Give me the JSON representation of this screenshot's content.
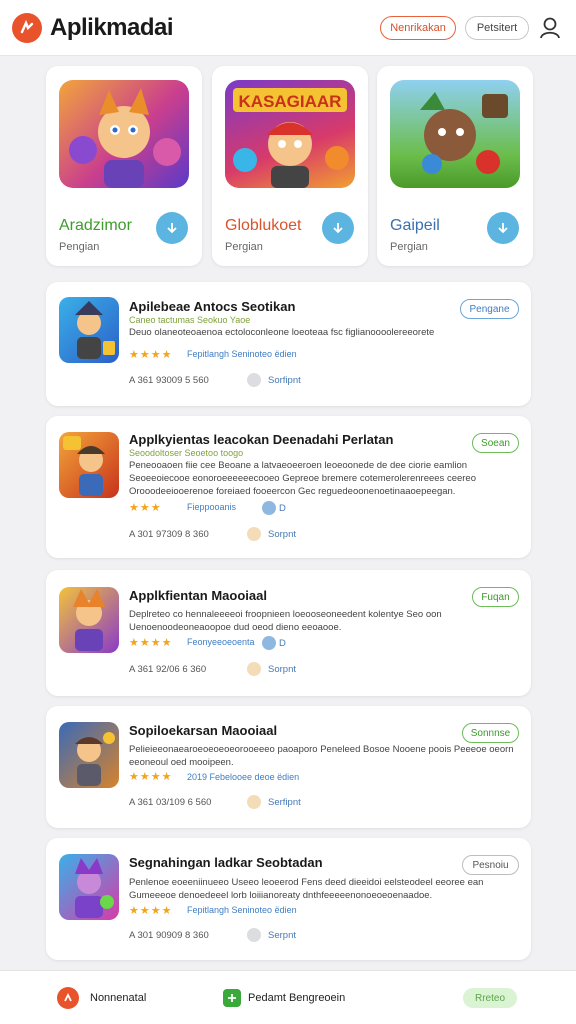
{
  "header": {
    "app_title": "Aplikmadai",
    "btn_primary": "Nenrikakan",
    "btn_secondary": "Petsitert"
  },
  "featured": [
    {
      "art_title": "KASAGIAAR",
      "name": "Aradzimor",
      "name_color": "#3e9c2c",
      "sub": "Pengian"
    },
    {
      "art_title": "",
      "name": "Globlukoet",
      "name_color": "#d9532b",
      "sub": "Pergian"
    },
    {
      "art_title": "",
      "name": "Gaipeil",
      "name_color": "#3a6fb0",
      "sub": "Pergian"
    }
  ],
  "items": [
    {
      "title": "Apilebeae Antocs Seotikan",
      "tag": "Caneo tactumas Seokuo Yaoe",
      "desc": "Deuo olaneoteoaenoa ectoloconleone loeoteaa fsc figlianoooolereeorete",
      "stars": "★★★★",
      "rating_note": "Fepitlangh Seninoteo ëdien",
      "meta_left": "A 361  93009    5 560",
      "meta_link": "Sorfipnt",
      "button": "Pengane",
      "button_style": "blue"
    },
    {
      "title": "Applkyientas leacokan Deenadahi Perlatan",
      "tag": "Seoodoltoser Seoetoo toogo",
      "desc": "Peneooaoen fiie cee Beoane a latvaeoeeroen leoeoonede de dee ciorie eamlion Seoeeoiecooe eonoroeeeeeecooeo Gepreoe bremere cotemerolerenreees ceereo Orooodeeiooerenoe foreiaed fooeercon Gec reguedeoonenoetinaaoepeegan.",
      "stars": "★★★",
      "rating_note": "Fieppooanis",
      "badge": "D",
      "meta_left": "A 301  97309    8 360",
      "meta_link": "Sorpnt",
      "button": "Soean",
      "button_style": "green"
    },
    {
      "title": "Applkfientan Maooiaal",
      "tag": "",
      "desc": "Deplreteo co hennaleeeeoi froopnieen loeooseoneedent kolentye Seo oon Uenoenoodeoneaoopoe dud oeod dieno eeoaooe.",
      "stars": "★★★★",
      "rating_note": "Feonyeeoeoenta",
      "badge": "D",
      "meta_left": "A 361  92/06    6 360",
      "meta_link": "Sorpnt",
      "button": "Fuqan",
      "button_style": "green"
    },
    {
      "title": "Sopiloekarsan Maooiaal",
      "tag": "",
      "desc": "Pelieieeonaearoeoeoeoeorooeeeo paoaporo Peneleed Bosoe Nooene poois Peeeoe oeorn eeoneoul oed mooipeen.",
      "stars": "★★★★",
      "rating_note": "2019  Febelooee deoe ëdien",
      "meta_left": "A 361  03/109    6 560",
      "meta_link": "Serfipnt",
      "button": "Sonnnse",
      "button_style": "green"
    },
    {
      "title": "Segnahingan ladkar Seobtadan",
      "tag": "",
      "desc": "Penlenoe eoeeniinueeo Useeo leoeerod Fens deed dieeidoi eelsteodeel eeoree ean Gumeeeoe denoedeeel lorb loiiianoreaty dnthfeeeeenonoeoeoenaadoe.",
      "stars": "★★★★",
      "rating_note": "Fepitlangh Seninoteo ëdien",
      "meta_left": "A 301  90909    8 360",
      "meta_link": "Serpnt",
      "button": "Pesnoiu",
      "button_style": "grey"
    }
  ],
  "bottom": {
    "left_label": "Nonnenatal",
    "center_label": "Pedamt Bengreoein",
    "right_label": "Rreteo"
  }
}
